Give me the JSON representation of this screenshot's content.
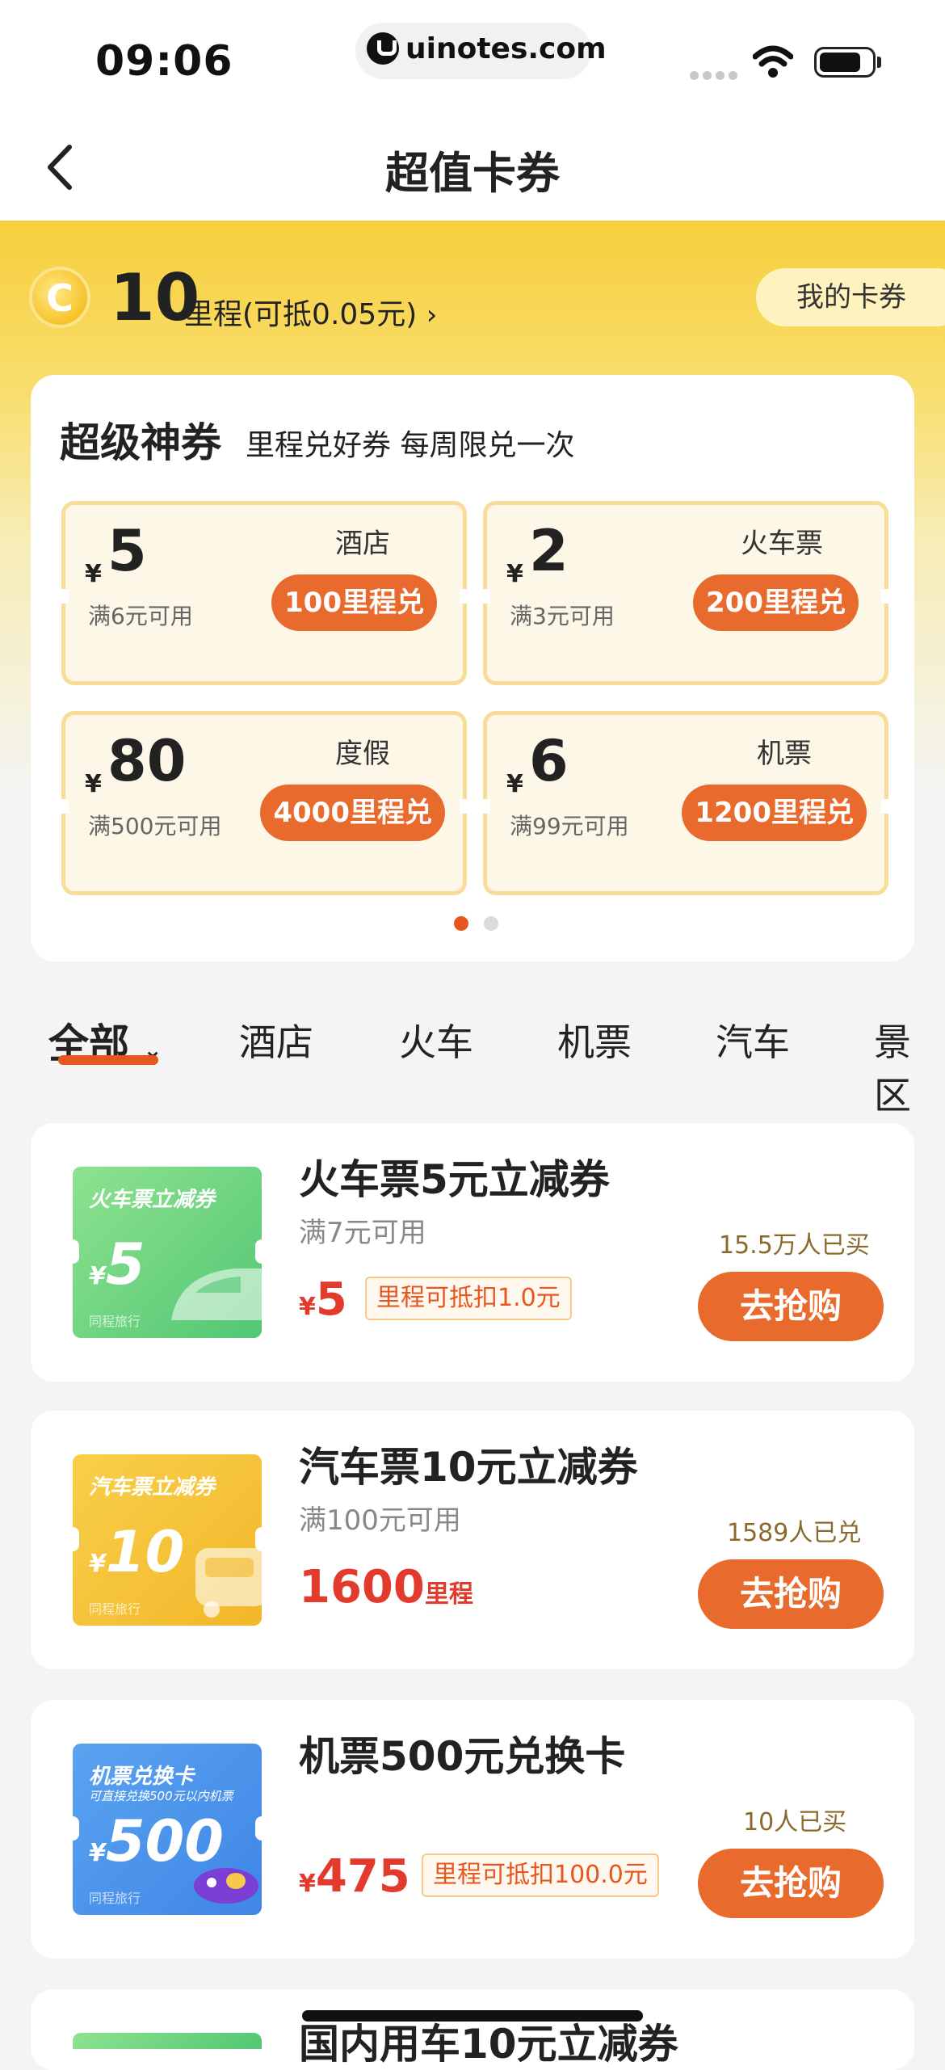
{
  "status": {
    "time": "09:06",
    "url": "uinotes.com"
  },
  "nav": {
    "title": "超值卡券"
  },
  "header": {
    "miles": "10",
    "miles_text": "里程(可抵0.05元)",
    "my_cards": "我的卡券"
  },
  "super": {
    "title": "超级神券",
    "subtitle": "里程兑好券 每周限兑一次",
    "coupons": [
      {
        "yen": "¥",
        "amount": "5",
        "condition": "满6元可用",
        "category": "酒店",
        "exchange": "100里程兑"
      },
      {
        "yen": "¥",
        "amount": "2",
        "condition": "满3元可用",
        "category": "火车票",
        "exchange": "200里程兑"
      },
      {
        "yen": "¥",
        "amount": "80",
        "condition": "满500元可用",
        "category": "度假",
        "exchange": "4000里程兑"
      },
      {
        "yen": "¥",
        "amount": "6",
        "condition": "满99元可用",
        "category": "机票",
        "exchange": "1200里程兑"
      }
    ],
    "page_active": 0
  },
  "tabs": [
    "全部",
    "酒店",
    "火车",
    "机票",
    "汽车",
    "景区"
  ],
  "products": [
    {
      "thumb_title": "火车票立减券",
      "thumb_sub": "",
      "thumb_yen": "¥",
      "thumb_amount": "5",
      "thumb_brand": "同程旅行",
      "title": "火车票5元立减券",
      "condition": "满7元可用",
      "price_prefix": "¥",
      "price": "5",
      "price_suffix": "",
      "tag": "里程可抵扣1.0元",
      "sold": "15.5万人已买",
      "button": "去抢购"
    },
    {
      "thumb_title": "汽车票立减券",
      "thumb_sub": "",
      "thumb_yen": "¥",
      "thumb_amount": "10",
      "thumb_brand": "同程旅行",
      "title": "汽车票10元立减券",
      "condition": "满100元可用",
      "price_prefix": "",
      "price": "1600",
      "price_suffix": "里程",
      "tag": "",
      "sold": "1589人已兑",
      "button": "去抢购"
    },
    {
      "thumb_title": "机票兑换卡",
      "thumb_sub": "可直接兑换500元以内机票",
      "thumb_yen": "¥",
      "thumb_amount": "500",
      "thumb_brand": "同程旅行",
      "title": "机票500元兑换卡",
      "condition": "",
      "price_prefix": "¥",
      "price": "475",
      "price_suffix": "",
      "tag": "里程可抵扣100.0元",
      "sold": "10人已买",
      "button": "去抢购"
    },
    {
      "title": "国内用车10元立减券"
    }
  ],
  "colors": {
    "accent": "#e86a2c",
    "price": "#e23b2e",
    "banner": "#f7cf3c"
  }
}
